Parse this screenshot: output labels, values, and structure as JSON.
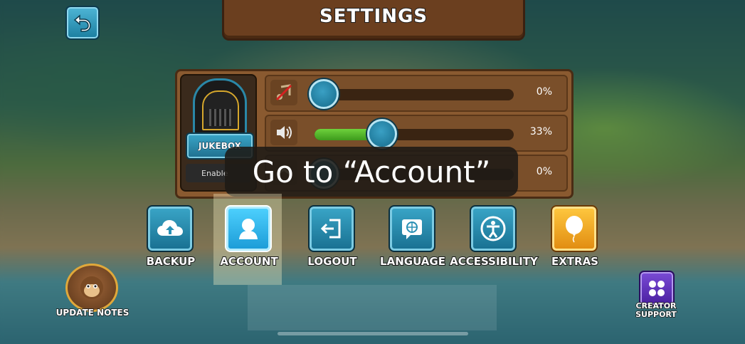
{
  "header": {
    "title": "SETTINGS"
  },
  "back_button": {
    "icon": "back-arrow-icon"
  },
  "jukebox": {
    "button_label": "JUKEBOX",
    "enable_label": "Enable"
  },
  "sliders": [
    {
      "icon": "music-muted-icon",
      "value_percent": 0,
      "value_label": "0%"
    },
    {
      "icon": "speaker-icon",
      "value_percent": 33,
      "value_label": "33%"
    },
    {
      "icon": "tweet-icon",
      "value_percent": 0,
      "value_label": "0%"
    }
  ],
  "tooltip": {
    "text": "Go to “Account”"
  },
  "menu": [
    {
      "label": "BACKUP",
      "icon": "cloud-upload-icon",
      "color": "#2a90b4"
    },
    {
      "label": "ACCOUNT",
      "icon": "account-icon",
      "color": "#1fb8f0",
      "selected": true
    },
    {
      "label": "LOGOUT",
      "icon": "logout-icon",
      "color": "#2a90b4"
    },
    {
      "label": "LANGUAGE",
      "icon": "language-icon",
      "color": "#2a90b4"
    },
    {
      "label": "ACCESSIBILITY",
      "icon": "accessibility-icon",
      "color": "#2a90b4"
    },
    {
      "label": "EXTRAS",
      "icon": "balloon-icon",
      "color": "#f0a820"
    }
  ],
  "update_notes": {
    "label": "UPDATE NOTES"
  },
  "creator_support": {
    "line1": "CREATOR",
    "line2": "SUPPORT"
  }
}
